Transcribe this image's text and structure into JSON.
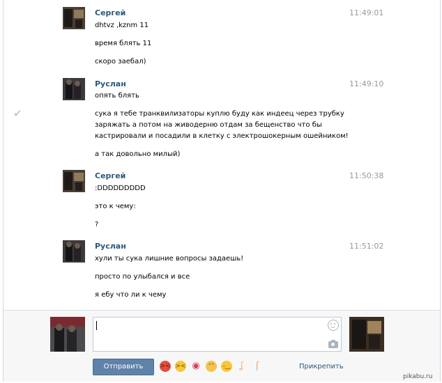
{
  "messages": [
    {
      "author": "Сергей",
      "time": "11:49:01",
      "lines": [
        "dhtvz ,kznm 11",
        "время блять 11",
        "скоро заебал)"
      ]
    },
    {
      "author": "Руслан",
      "time": "11:49:10",
      "lines": [
        "опять блять",
        "сука я тебе транквилизаторы куплю буду как индеец через трубку",
        "заряжать а потом на живодерню отдам за бещенство что бы",
        "кастрировали и посадили в клетку с электрошокерным ошейником!",
        "а так довольно милый)"
      ]
    },
    {
      "author": "Сергей",
      "time": "11:50:38",
      "lines": [
        ":DDDDDDDDD",
        "это к чему:",
        "?"
      ]
    },
    {
      "author": "Руслан",
      "time": "11:51:02",
      "lines": [
        "хули ты сука лишние вопросы задаешь!",
        "просто по улыбался и все",
        "я ебу что ли к чему"
      ]
    }
  ],
  "composer": {
    "message_value": "",
    "send_label": "Отправить",
    "attach_label": "Прикрепить",
    "emojis": [
      "angry-face",
      "grinning-squint-face",
      "kiss-lips",
      "flushed-face",
      "smirk-face",
      "nose",
      "ear"
    ]
  },
  "watermark": "pikabu.ru",
  "colors": {
    "author": "#2b587a",
    "send_button": "#5e82a8",
    "time": "#999999"
  }
}
